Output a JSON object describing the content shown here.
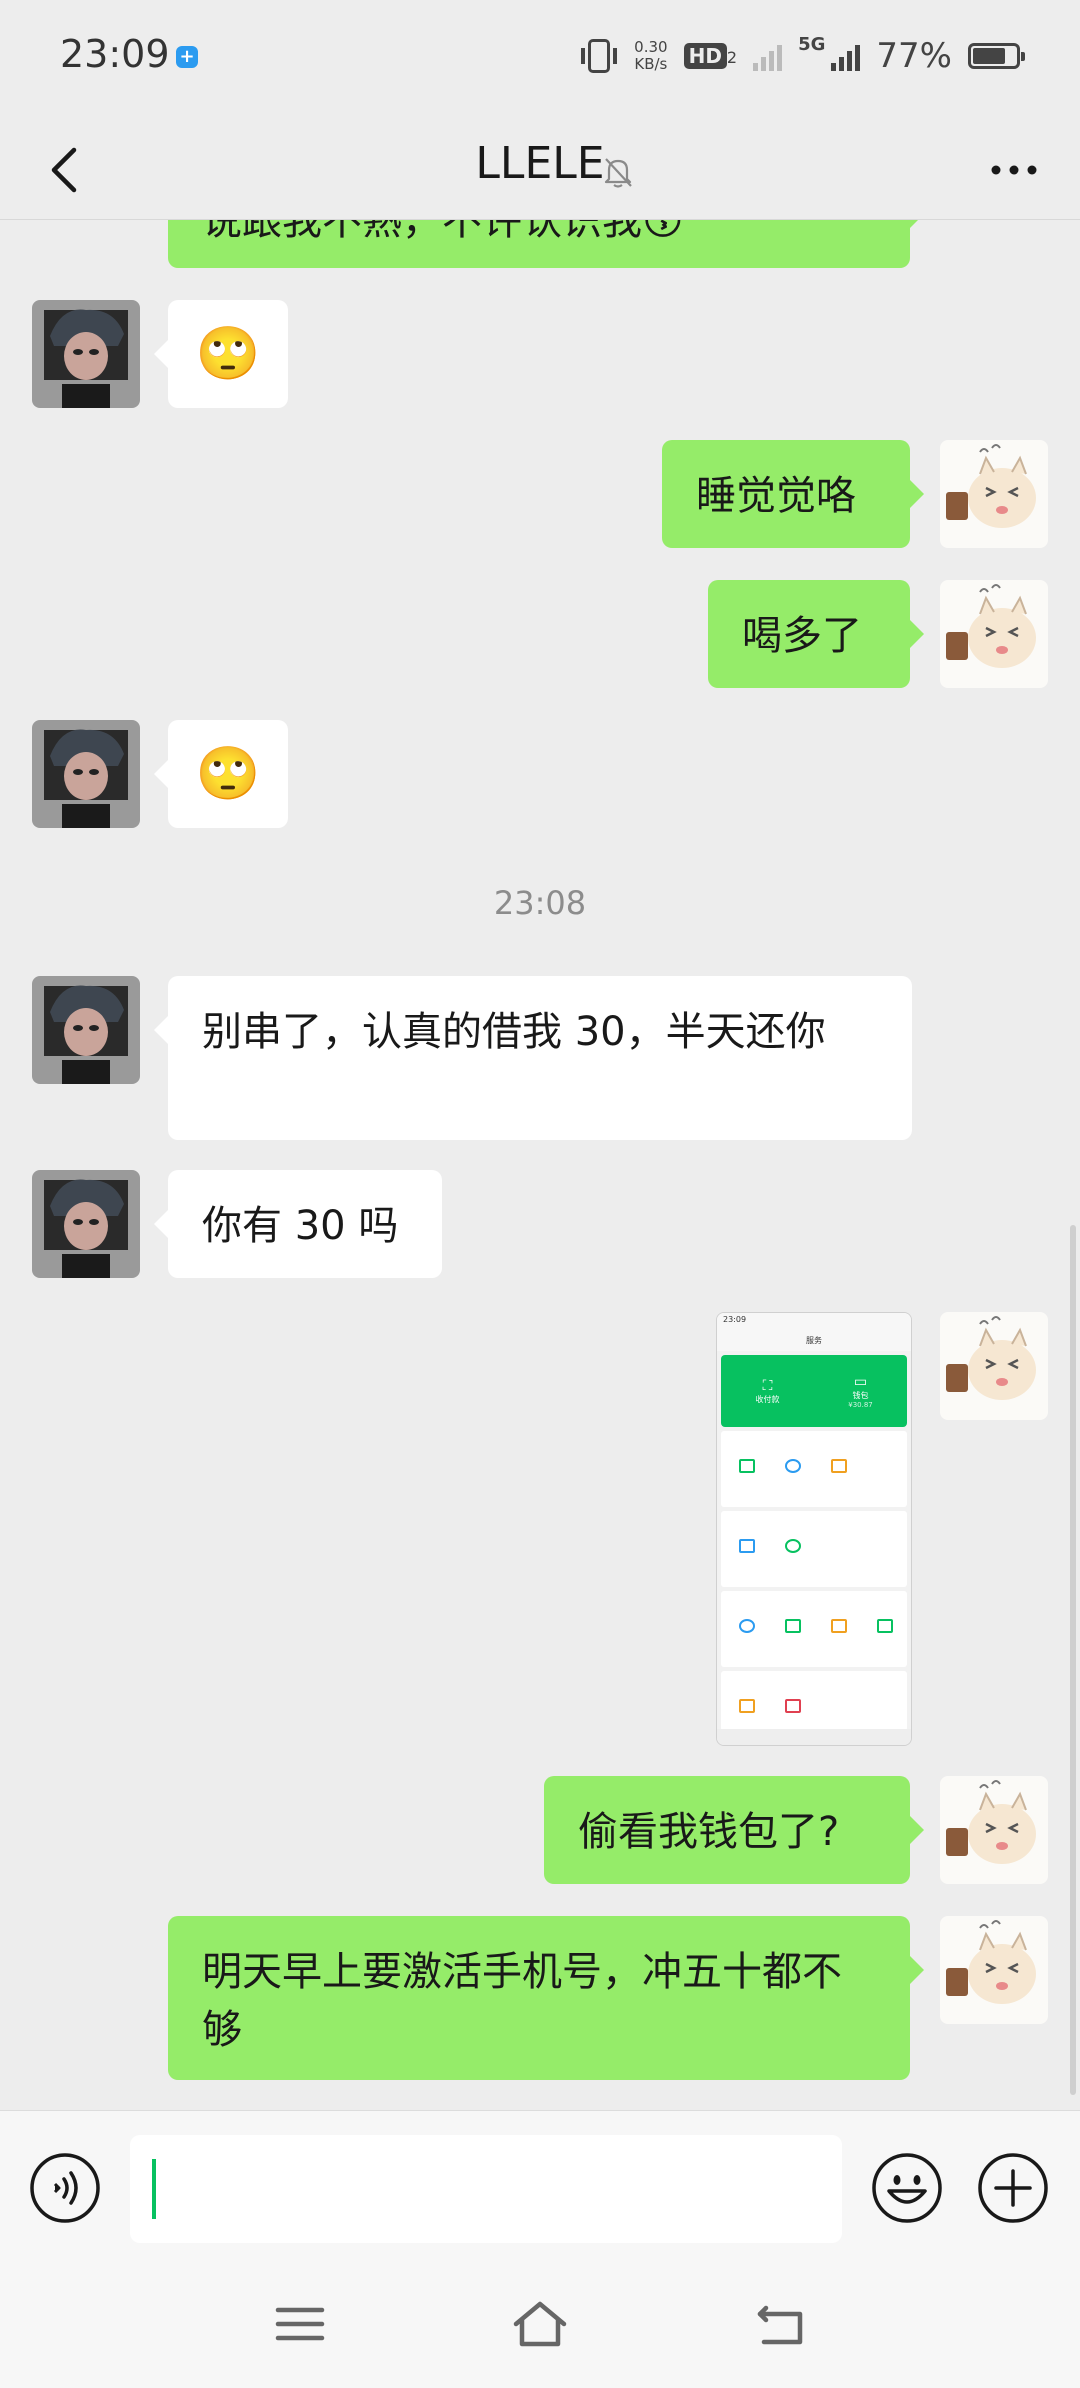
{
  "status_bar": {
    "time": "23:09",
    "speed_value": "0.30",
    "speed_unit": "KB/s",
    "hd": "HD",
    "hd_sub": "2",
    "network": "5G",
    "battery": "77%",
    "battery_level": 0.77
  },
  "header": {
    "title": "LLELE"
  },
  "messages": {
    "m0": "说跟我不熟，不许认识我😗",
    "m1": "🙄",
    "m2": "睡觉觉咯",
    "m3": "喝多了",
    "m4": "🙄",
    "time_sep": "23:08",
    "m5": "别串了，认真的借我 30，半天还你",
    "m6": "你有 30 吗",
    "m8": "偷看我钱包了?",
    "m9": "明天早上要激活手机号，冲五十都不够"
  },
  "screenshot_thumb": {
    "title": "服务",
    "left_label": "收付款",
    "right_label": "钱包",
    "right_value": "¥30.87"
  },
  "input": {
    "value": ""
  },
  "colors": {
    "background": "#EDEDED",
    "outgoing_bubble": "#95EC69",
    "incoming_bubble": "#FFFFFF",
    "accent": "#07C160"
  }
}
